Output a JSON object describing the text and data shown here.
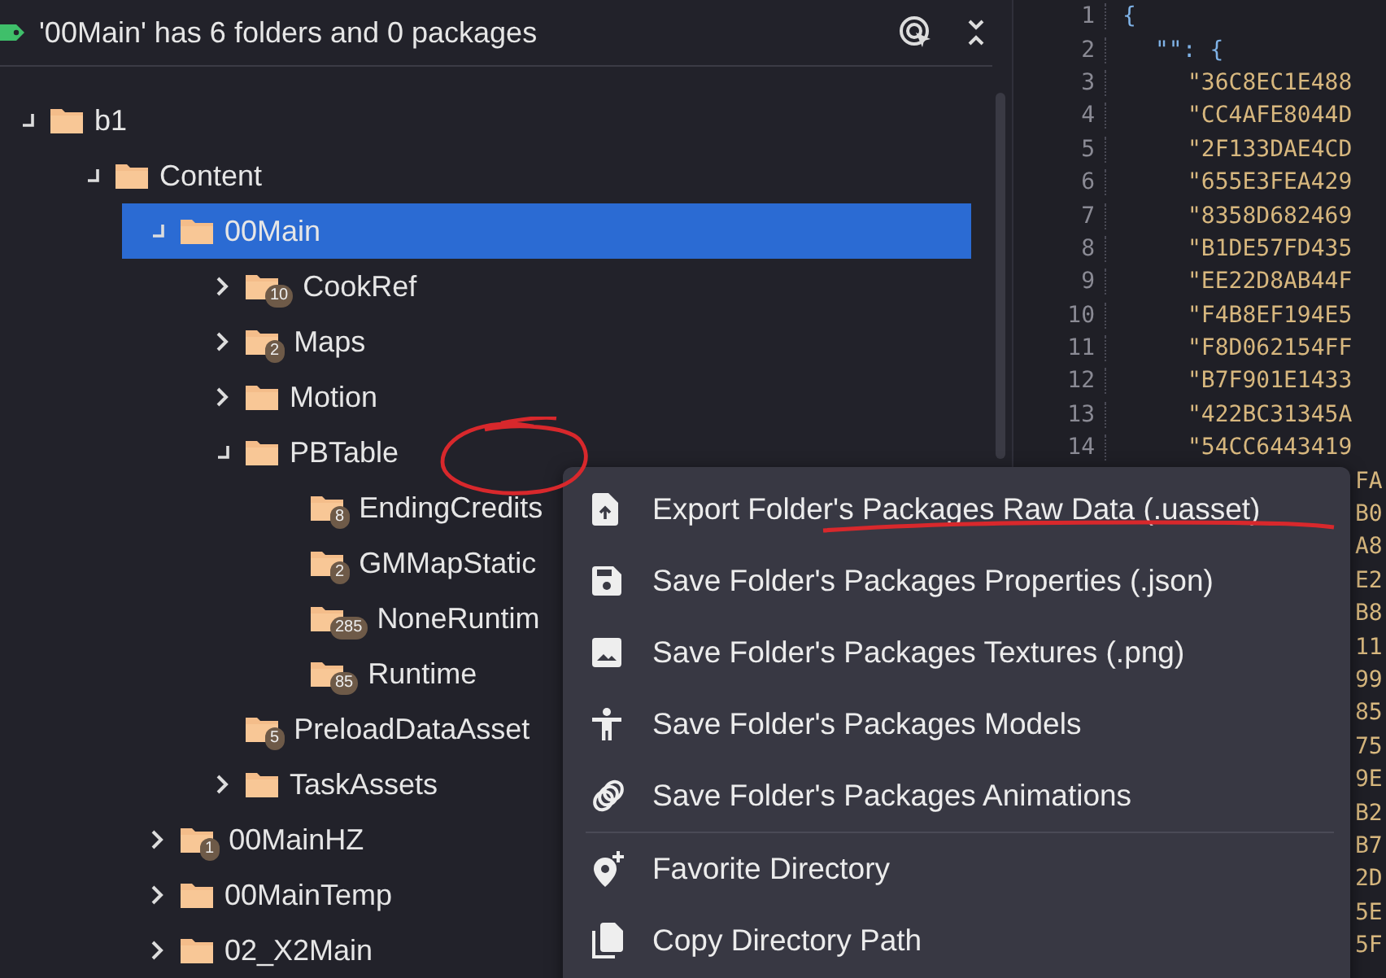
{
  "header": {
    "title": "'00Main' has 6 folders and 0 packages"
  },
  "tree": [
    {
      "name": "b1",
      "expanded": true,
      "selected": false,
      "children": [
        {
          "name": "Content",
          "expanded": true,
          "selected": false,
          "children": [
            {
              "name": "00Main",
              "expanded": true,
              "selected": true,
              "children": [
                {
                  "name": "CookRef",
                  "expanded": false,
                  "selected": false,
                  "count": "10"
                },
                {
                  "name": "Maps",
                  "expanded": false,
                  "selected": false,
                  "count": "2"
                },
                {
                  "name": "Motion",
                  "expanded": false,
                  "selected": false
                },
                {
                  "name": "PBTable",
                  "expanded": true,
                  "selected": false,
                  "children": [
                    {
                      "name": "EndingCredits",
                      "selected": false,
                      "count": "8"
                    },
                    {
                      "name": "GMMapStatic",
                      "selected": false,
                      "count": "2"
                    },
                    {
                      "name": "NoneRuntim",
                      "selected": false,
                      "count": "285"
                    },
                    {
                      "name": "Runtime",
                      "selected": false,
                      "count": "85"
                    }
                  ]
                },
                {
                  "name": "PreloadDataAsset",
                  "selected": false,
                  "count": "5"
                },
                {
                  "name": "TaskAssets",
                  "expanded": false,
                  "selected": false
                }
              ]
            },
            {
              "name": "00MainHZ",
              "expanded": false,
              "selected": false,
              "count": "1"
            },
            {
              "name": "00MainTemp",
              "expanded": false,
              "selected": false
            },
            {
              "name": "02_X2Main",
              "expanded": false,
              "selected": false
            }
          ]
        }
      ]
    }
  ],
  "code_lines": [
    {
      "number": "1",
      "text": "{"
    },
    {
      "number": "2",
      "text": "\"\": {"
    },
    {
      "number": "3",
      "text": "\"36C8EC1E488"
    },
    {
      "number": "4",
      "text": "\"CC4AFE8044D"
    },
    {
      "number": "5",
      "text": "\"2F133DAE4CD"
    },
    {
      "number": "6",
      "text": "\"655E3FEA429"
    },
    {
      "number": "7",
      "text": "\"8358D682469"
    },
    {
      "number": "8",
      "text": "\"B1DE57FD435"
    },
    {
      "number": "9",
      "text": "\"EE22D8AB44F"
    },
    {
      "number": "10",
      "text": "\"F4B8EF194E5"
    },
    {
      "number": "11",
      "text": "\"F8D062154FF"
    },
    {
      "number": "12",
      "text": "\"B7F901E1433"
    },
    {
      "number": "13",
      "text": "\"422BC31345A"
    },
    {
      "number": "14",
      "text": "\"54CC6443419"
    }
  ],
  "line_tails": [
    "FA",
    "B0",
    "A8",
    "E2",
    "B8",
    "11",
    "99",
    "85",
    "75",
    "9E",
    "B2",
    "B7",
    "2D",
    "5E",
    "5F"
  ],
  "context_menu": [
    {
      "kind": "item",
      "label": "Export Folder's Packages Raw Data (.uasset)"
    },
    {
      "kind": "item",
      "label": "Save Folder's Packages Properties (.json)"
    },
    {
      "kind": "item",
      "label": "Save Folder's Packages Textures (.png)"
    },
    {
      "kind": "item",
      "label": "Save Folder's Packages Models"
    },
    {
      "kind": "item",
      "label": "Save Folder's Packages Animations"
    },
    {
      "kind": "separator"
    },
    {
      "kind": "item",
      "label": "Favorite Directory"
    },
    {
      "kind": "item",
      "label": "Copy Directory Path"
    }
  ]
}
